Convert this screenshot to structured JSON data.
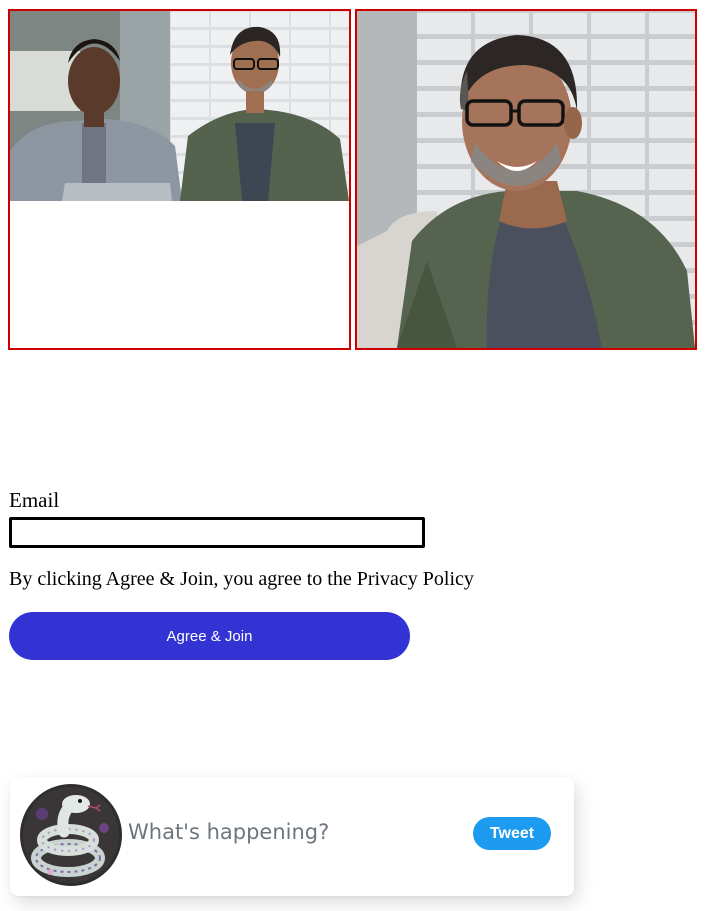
{
  "gallery": {
    "photos": [
      {
        "description": "two men seated side by side in a bright office"
      },
      {
        "description": "smiling man with glasses in a green blazer"
      }
    ],
    "frame_color": "#cc0000"
  },
  "signup": {
    "email_label": "Email",
    "email_value": "",
    "consent_text": "By clicking Agree & Join, you agree to the Privacy Policy",
    "agree_button_label": "Agree & Join",
    "button_color": "#3333d4"
  },
  "composer": {
    "placeholder": "What's happening?",
    "tweet_button_label": "Tweet",
    "button_color": "#1d9bf0",
    "avatar_icon": "snake-avatar-icon"
  }
}
